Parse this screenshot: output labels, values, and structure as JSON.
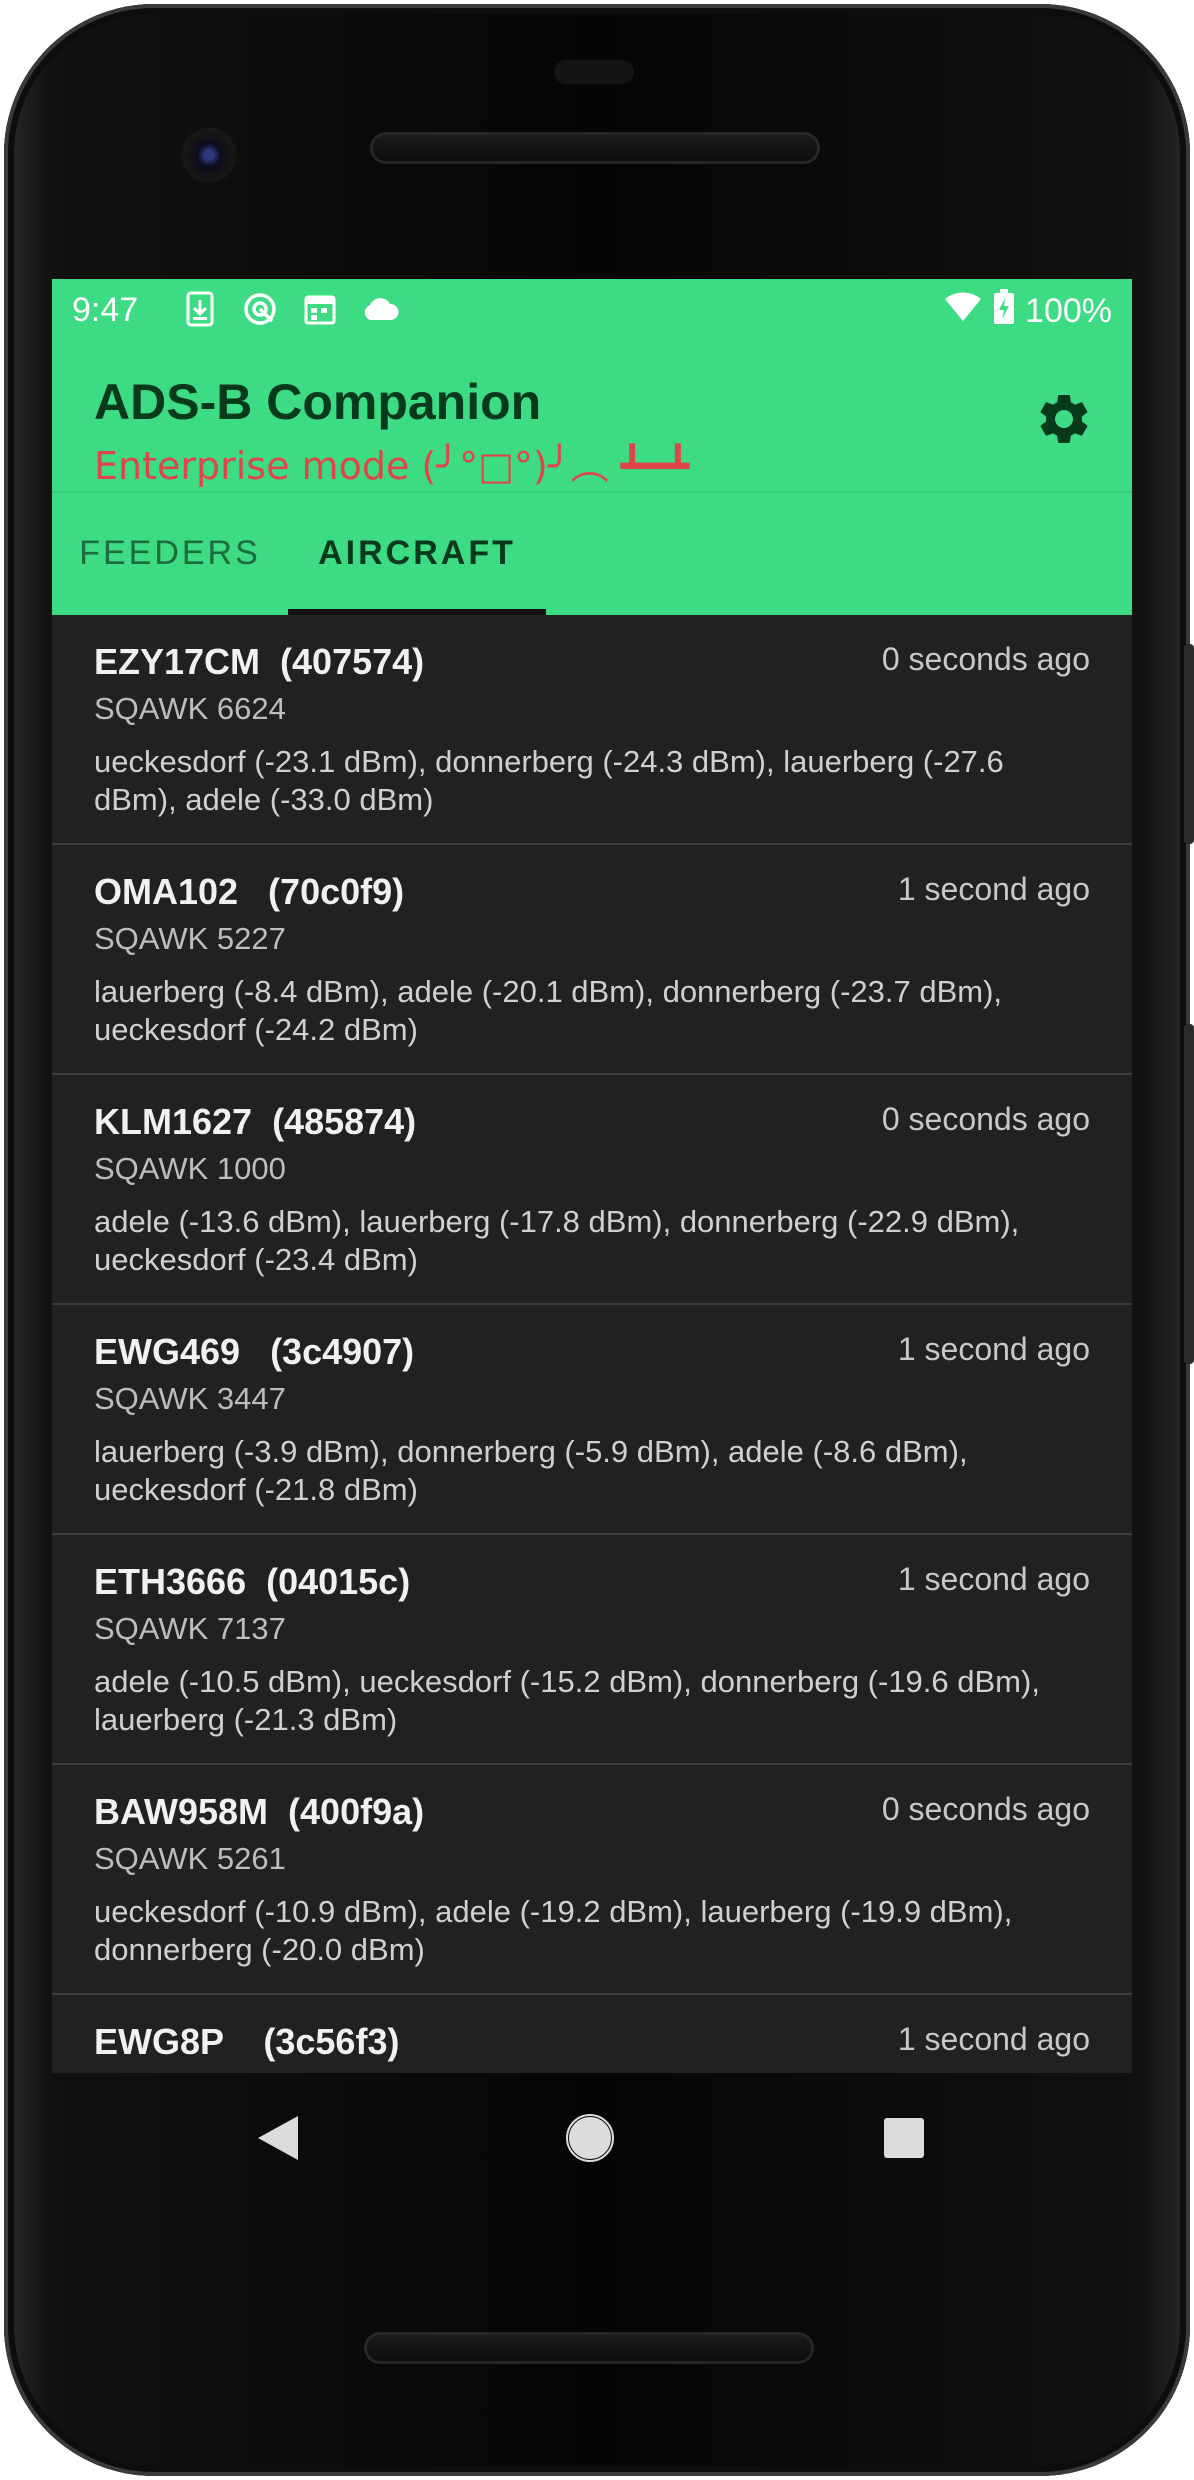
{
  "status_bar": {
    "time": "9:47",
    "battery": "100%",
    "icons": [
      "download-icon",
      "sync-icon",
      "calendar-icon",
      "cloud-icon",
      "wifi-icon",
      "battery-charging-icon"
    ]
  },
  "app_bar": {
    "title": "ADS-B Companion",
    "subtitle": "Enterprise mode (╯°□°)╯︵ ┻━┻",
    "settings_icon": "gear-icon"
  },
  "tabs": [
    {
      "label": "FEEDERS",
      "selected": false
    },
    {
      "label": "AIRCRAFT",
      "selected": true
    }
  ],
  "aircraft": [
    {
      "callsign": "EZY17CM  (407574)",
      "ago": "0 seconds ago",
      "squawk": "SQAWK 6624",
      "receivers": "ueckesdorf (-23.1 dBm), donnerberg (-24.3 dBm), lauerberg (-27.6 dBm), adele (-33.0 dBm)"
    },
    {
      "callsign": "OMA102   (70c0f9)",
      "ago": "1 second ago",
      "squawk": "SQAWK 5227",
      "receivers": "lauerberg (-8.4 dBm), adele (-20.1 dBm), donnerberg (-23.7 dBm), ueckesdorf (-24.2 dBm)"
    },
    {
      "callsign": "KLM1627  (485874)",
      "ago": "0 seconds ago",
      "squawk": "SQAWK 1000",
      "receivers": "adele (-13.6 dBm), lauerberg (-17.8 dBm), donnerberg (-22.9 dBm), ueckesdorf (-23.4 dBm)"
    },
    {
      "callsign": "EWG469   (3c4907)",
      "ago": "1 second ago",
      "squawk": "SQAWK 3447",
      "receivers": "lauerberg (-3.9 dBm), donnerberg (-5.9 dBm), adele (-8.6 dBm), ueckesdorf (-21.8 dBm)"
    },
    {
      "callsign": "ETH3666  (04015c)",
      "ago": "1 second ago",
      "squawk": "SQAWK 7137",
      "receivers": "adele (-10.5 dBm), ueckesdorf (-15.2 dBm), donnerberg (-19.6 dBm), lauerberg (-21.3 dBm)"
    },
    {
      "callsign": "BAW958M  (400f9a)",
      "ago": "0 seconds ago",
      "squawk": "SQAWK 5261",
      "receivers": "ueckesdorf (-10.9 dBm), adele (-19.2 dBm), lauerberg (-19.9 dBm), donnerberg (-20.0 dBm)"
    },
    {
      "callsign": "EWG8P    (3c56f3)",
      "ago": "1 second ago",
      "squawk": "",
      "receivers": ""
    }
  ],
  "colors": {
    "accent": "#3ddc84",
    "title": "#063a1a",
    "subtitle": "#e0454a",
    "list_bg": "#202122"
  },
  "nav": {
    "back_icon": "back-triangle-icon",
    "home_icon": "home-circle-icon",
    "recents_icon": "recents-square-icon"
  }
}
